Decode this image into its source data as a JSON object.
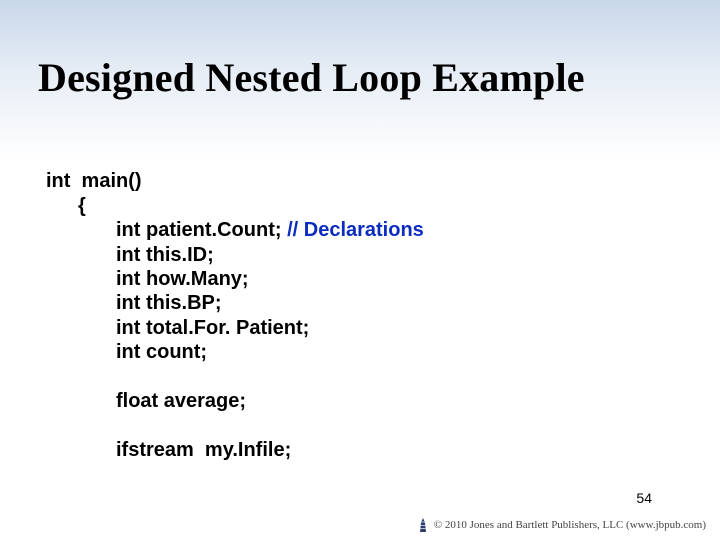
{
  "title": "Designed Nested Loop Example",
  "code": {
    "l1": "int  main()",
    "l2": "{",
    "l3a": "int patient.Count; ",
    "l3b": "// Declarations",
    "l4": "int this.ID;",
    "l5": "int how.Many;",
    "l6": "int this.BP;",
    "l7": "int total.For. Patient;",
    "l8": "int count;",
    "l9": "float average;",
    "l10": "ifstream  my.Infile;"
  },
  "page_number": "54",
  "footer": {
    "text": "© 2010 Jones and Bartlett Publishers, LLC (www.jbpub.com)"
  }
}
